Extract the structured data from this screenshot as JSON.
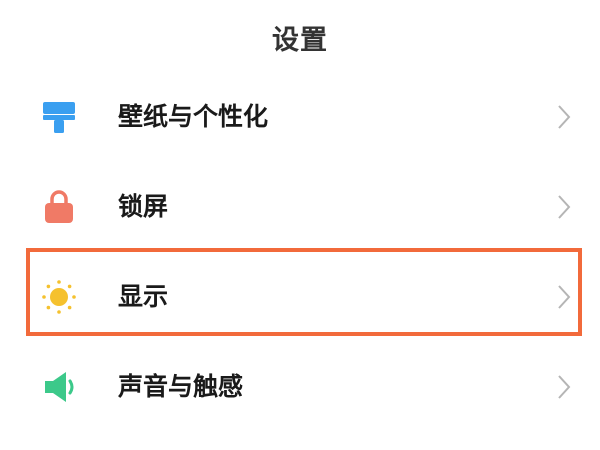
{
  "header": {
    "title": "设置"
  },
  "settings": {
    "items": [
      {
        "label": "壁纸与个性化",
        "icon": "wallpaper-brush-icon",
        "icon_color": "#3a9ff0"
      },
      {
        "label": "锁屏",
        "icon": "lock-icon",
        "icon_color": "#f07a66"
      },
      {
        "label": "显示",
        "icon": "sun-icon",
        "icon_color": "#f5c12e"
      },
      {
        "label": "声音与触感",
        "icon": "speaker-icon",
        "icon_color": "#3cc98a"
      }
    ]
  },
  "highlight": {
    "target": "显示",
    "color": "#f26a3b"
  },
  "colors": {
    "chevron": "#b5b5b5",
    "text": "#1a1a1a"
  }
}
